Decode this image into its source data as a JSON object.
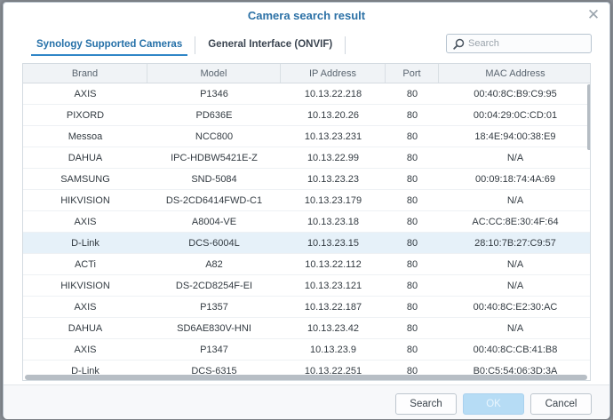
{
  "dialog": {
    "title": "Camera search result"
  },
  "tabs": [
    {
      "label": "Synology Supported Cameras",
      "active": true
    },
    {
      "label": "General Interface (ONVIF)",
      "active": false
    }
  ],
  "search": {
    "placeholder": "Search"
  },
  "table": {
    "columns": [
      "Brand",
      "Model",
      "IP Address",
      "Port",
      "MAC Address"
    ],
    "rows": [
      [
        "AXIS",
        "P1346",
        "10.13.22.218",
        "80",
        "00:40:8C:B9:C9:95"
      ],
      [
        "PIXORD",
        "PD636E",
        "10.13.20.26",
        "80",
        "00:04:29:0C:CD:01"
      ],
      [
        "Messoa",
        "NCC800",
        "10.13.23.231",
        "80",
        "18:4E:94:00:38:E9"
      ],
      [
        "DAHUA",
        "IPC-HDBW5421E-Z",
        "10.13.22.99",
        "80",
        "N/A"
      ],
      [
        "SAMSUNG",
        "SND-5084",
        "10.13.23.23",
        "80",
        "00:09:18:74:4A:69"
      ],
      [
        "HIKVISION",
        "DS-2CD6414FWD-C1",
        "10.13.23.179",
        "80",
        "N/A"
      ],
      [
        "AXIS",
        "A8004-VE",
        "10.13.23.18",
        "80",
        "AC:CC:8E:30:4F:64"
      ],
      [
        "D-Link",
        "DCS-6004L",
        "10.13.23.15",
        "80",
        "28:10:7B:27:C9:57"
      ],
      [
        "ACTi",
        "A82",
        "10.13.22.112",
        "80",
        "N/A"
      ],
      [
        "HIKVISION",
        "DS-2CD8254F-EI",
        "10.13.23.121",
        "80",
        "N/A"
      ],
      [
        "AXIS",
        "P1357",
        "10.13.22.187",
        "80",
        "00:40:8C:E2:30:AC"
      ],
      [
        "DAHUA",
        "SD6AE830V-HNI",
        "10.13.23.42",
        "80",
        "N/A"
      ],
      [
        "AXIS",
        "P1347",
        "10.13.23.9",
        "80",
        "00:40:8C:CB:41:B8"
      ],
      [
        "D-Link",
        "DCS-6315",
        "10.13.22.251",
        "80",
        "B0:C5:54:06:3D:3A"
      ]
    ],
    "selected_row": 7
  },
  "buttons": {
    "search": "Search",
    "ok": "OK",
    "cancel": "Cancel"
  },
  "colors": {
    "accent": "#2f86c7",
    "title": "#2c71a6",
    "selected_row": "#e6f1f9",
    "ok_disabled": "#b6dcf5"
  }
}
